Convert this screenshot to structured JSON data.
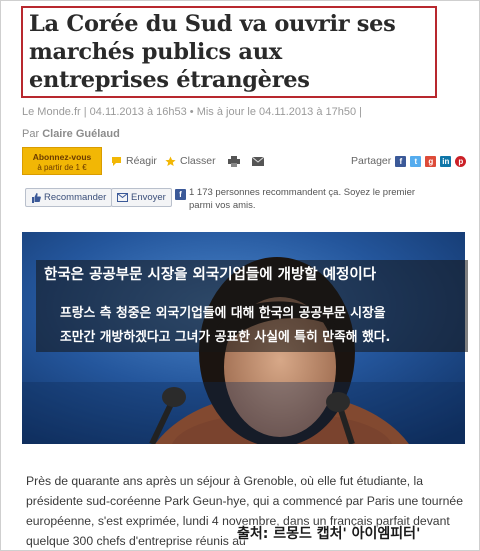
{
  "headline": "La Corée du Sud va ouvrir ses marchés publics aux entreprises étrangères",
  "meta": "Le Monde.fr | 04.11.2013 à 16h53 • Mis à jour le 04.11.2013 à 17h50 |",
  "byline": {
    "prefix": "Par",
    "author": "Claire Guélaud"
  },
  "toolbar": {
    "subscribe_line1": "Abonnez-vous",
    "subscribe_line2": "à partir de 1 €",
    "react": "Réagir",
    "classer": "Classer",
    "share": "Partager"
  },
  "social": {
    "recommend": "Recommander",
    "send": "Envoyer",
    "fb_count": "1 173 personnes recommandent ça. Soyez le premier parmi vos amis."
  },
  "photo_caption": {
    "title": "한국은 공공부문 시장을 외국기업들에 개방할 예정이다",
    "line1": "프랑스 측 청중은 외국기업들에 대해 한국의 공공부문 시장을",
    "line2": "조만간 개방하겠다고 그녀가 공표한 사실에 특히 만족해 했다."
  },
  "article": {
    "line1": "Près de quarante ans après un séjour à Grenoble, où elle fut étudiante, la",
    "line2": "présidente sud-coréenne Park Geun-hye, qui a commencé par Paris une tournée",
    "line3": "européenne, s'est exprimée, lundi 4 novembre, dans un français parfait devant",
    "line4": "quelque 300 chefs d'entreprise réunis au"
  },
  "credit": "출처: 르몽드 캡처' 아이엠피터'",
  "colors": {
    "headline_border": "#b8282e",
    "subscribe_bg": "#f2b705",
    "photo_bg": "#1f4f93"
  },
  "icons": [
    "comment-icon",
    "star-icon",
    "print-icon",
    "mail-icon",
    "facebook-icon",
    "twitter-icon",
    "google-plus-icon",
    "linkedin-icon",
    "pinterest-icon",
    "thumbs-up-icon",
    "envelope-icon"
  ]
}
